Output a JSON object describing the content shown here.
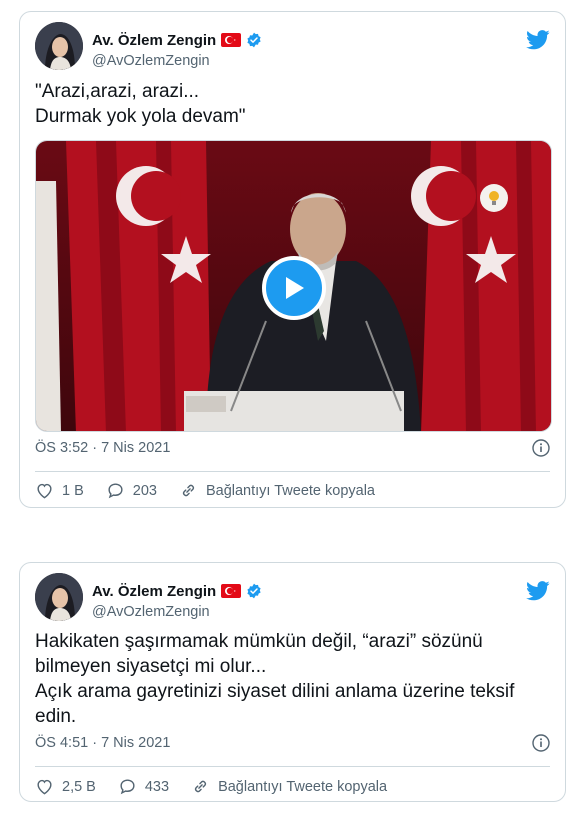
{
  "tweets": [
    {
      "author": {
        "name": "Av. Özlem Zengin",
        "handle": "@AvOzlemZengin",
        "verified": true,
        "flag": "turkey-flag-emoji"
      },
      "text": "\"Arazi,arazi, arazi...\nDurmak yok yola devam\"",
      "media": {
        "type": "video",
        "has_play_button": true
      },
      "timestamp": "ÖS 3:52 · 7 Nis 2021",
      "likes": "1 B",
      "replies": "203",
      "copy_link_label": "Bağlantıyı Tweete kopyala"
    },
    {
      "author": {
        "name": "Av. Özlem Zengin",
        "handle": "@AvOzlemZengin",
        "verified": true,
        "flag": "turkey-flag-emoji"
      },
      "text": "Hakikaten şaşırmamak mümkün değil, “arazi” sözünü\nbilmeyen siyasetçi mi olur...\nAçık arama gayretinizi siyaset dilini anlama üzerine teksif\nedin.",
      "timestamp": "ÖS 4:51 · 7 Nis 2021",
      "likes": "2,5 B",
      "replies": "433",
      "copy_link_label": "Bağlantıyı Tweete kopyala"
    }
  ],
  "colors": {
    "twitter_blue": "#1d9bf0",
    "verified_blue": "#1d9bf0",
    "secondary_text": "#536471",
    "border": "#cfd9de",
    "flag_red": "#e30a17"
  }
}
